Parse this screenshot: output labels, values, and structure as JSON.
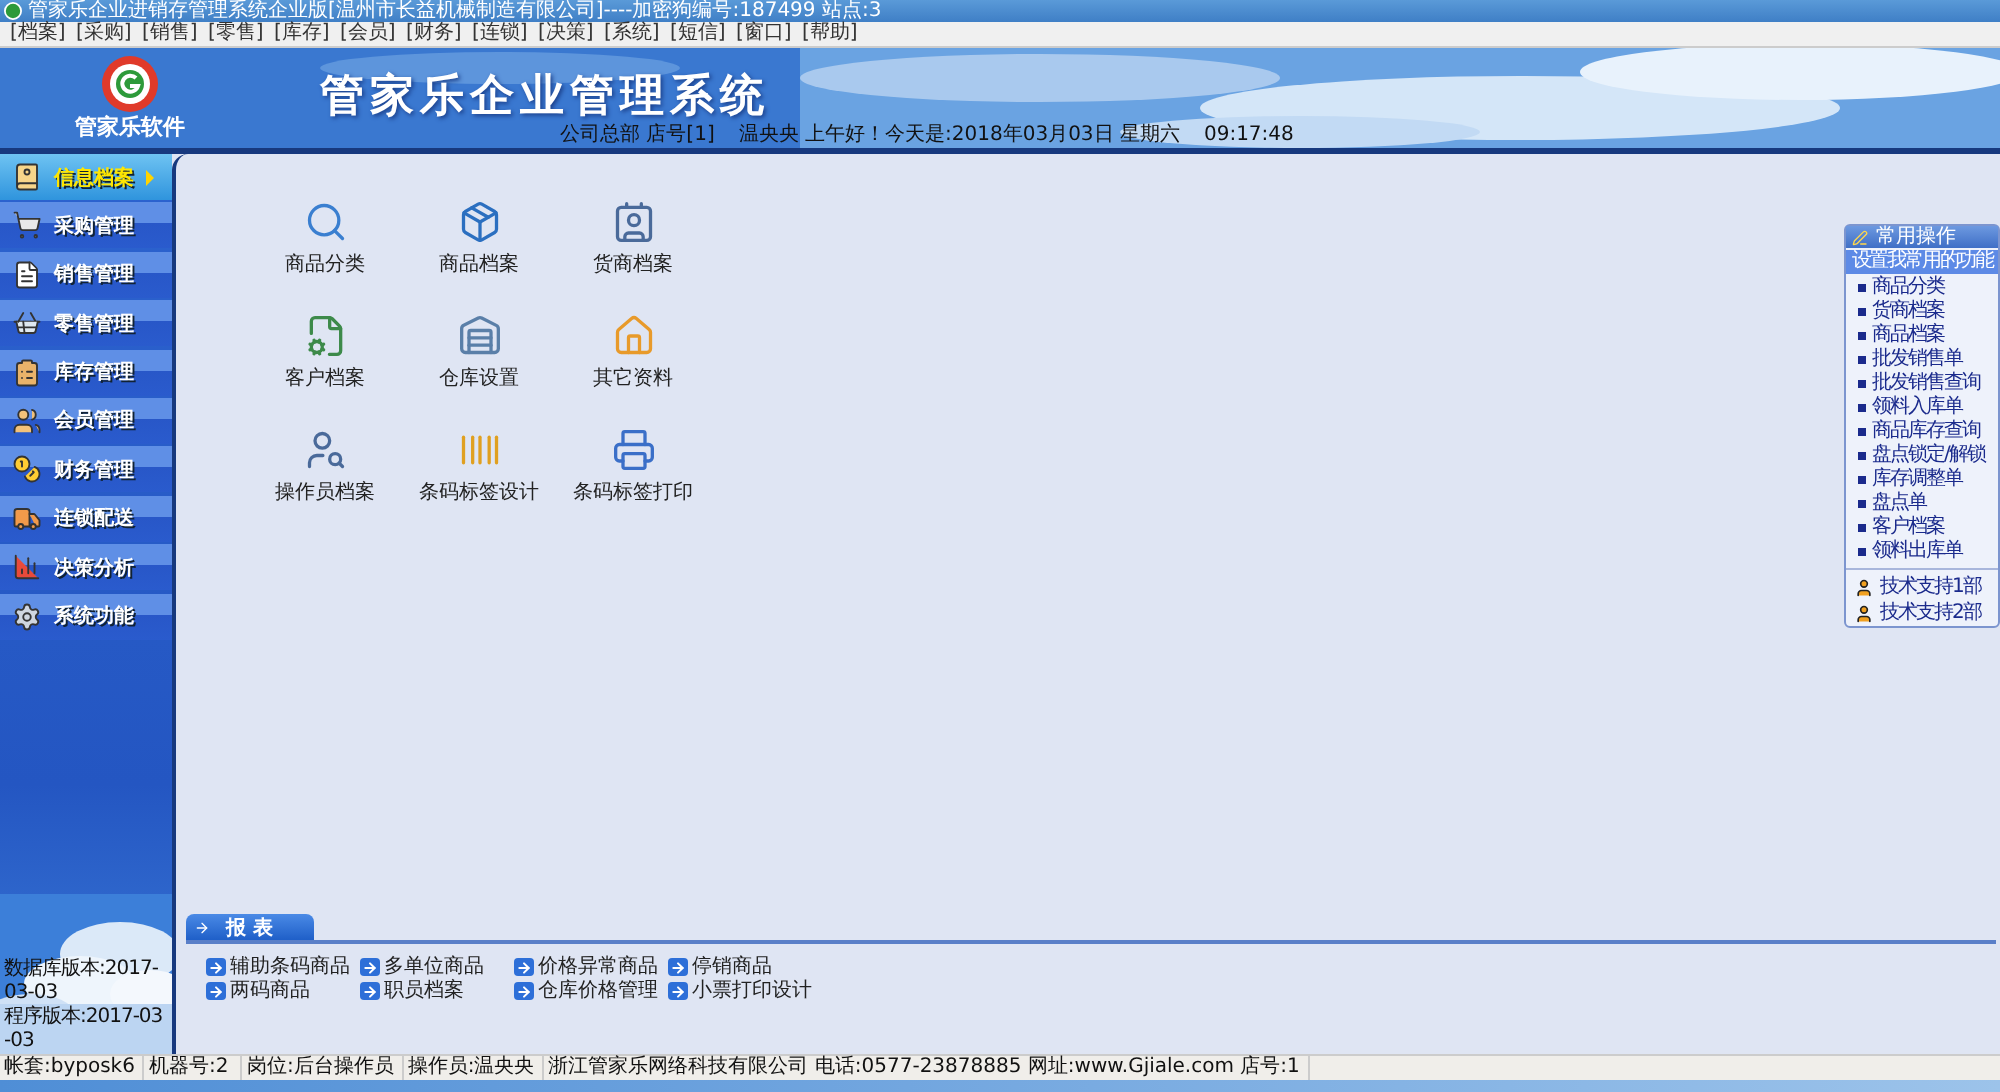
{
  "window": {
    "title": "管家乐企业进销存管理系统企业版[温州市长益机械制造有限公司]----加密狗编号:187499 站点:3"
  },
  "menu": [
    "[档案]",
    "[采购]",
    "[销售]",
    "[零售]",
    "[库存]",
    "[会员]",
    "[财务]",
    "[连锁]",
    "[决策]",
    "[系统]",
    "[短信]",
    "[窗口]",
    "[帮助]"
  ],
  "banner": {
    "brand": "管家乐软件",
    "title": "管家乐企业管理系统",
    "store": "公司总部 店号[1]",
    "greeting": "温央央 上午好！今天是:2018年03月03日 星期六",
    "time": "09:17:48"
  },
  "sidebar": {
    "items": [
      {
        "label": "信息档案",
        "selected": true
      },
      {
        "label": "采购管理",
        "selected": false
      },
      {
        "label": "销售管理",
        "selected": false
      },
      {
        "label": "零售管理",
        "selected": false
      },
      {
        "label": "库存管理",
        "selected": false
      },
      {
        "label": "会员管理",
        "selected": false
      },
      {
        "label": "财务管理",
        "selected": false
      },
      {
        "label": "连锁配送",
        "selected": false
      },
      {
        "label": "决策分析",
        "selected": false
      },
      {
        "label": "系统功能",
        "selected": false
      }
    ],
    "versions": [
      "数据库版本:2017-03-03",
      "程序版本:2017-03-03"
    ]
  },
  "modules": [
    "商品分类",
    "商品档案",
    "货商档案",
    "客户档案",
    "仓库设置",
    "其它资料",
    "操作员档案",
    "条码标签设计",
    "条码标签打印"
  ],
  "quick_panel": {
    "title": "常用操作",
    "setup_link": "设置我常用的功能",
    "items": [
      "商品分类",
      "货商档案",
      "商品档案",
      "批发销售单",
      "批发销售查询",
      "领料入库单",
      "商品库存查询",
      "盘点锁定/解锁",
      "库存调整单",
      "盘点单",
      "客户档案",
      "领料出库单"
    ],
    "support": [
      "技术支持1部",
      "技术支持2部"
    ]
  },
  "reports": {
    "title": "报 表",
    "links": [
      "辅助条码商品",
      "多单位商品",
      "价格异常商品",
      "停销商品",
      "两码商品",
      "职员档案",
      "仓库价格管理",
      "小票打印设计"
    ]
  },
  "status_bar": [
    "帐套:byposk6",
    "机器号:2",
    "岗位:后台操作员",
    "操作员:温央央",
    "浙江管家乐网络科技有限公司 电话:0577-23878885 网址:www.Gjiale.com 店号:1"
  ]
}
